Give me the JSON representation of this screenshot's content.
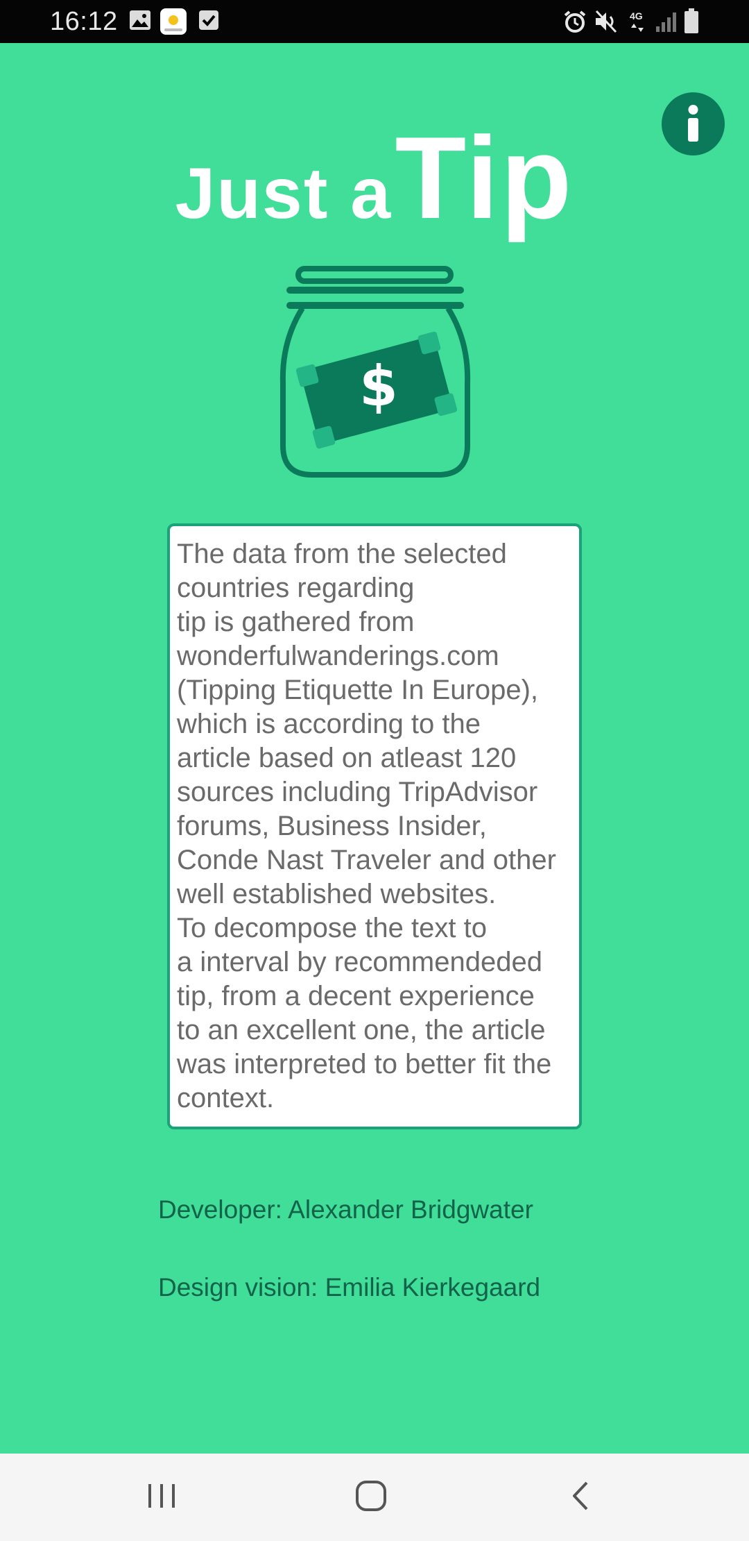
{
  "status_bar": {
    "time": "16:12",
    "left_icons": [
      "image-icon",
      "weather-app-icon",
      "checkbox-icon"
    ],
    "right_icons": [
      "alarm-icon",
      "mute-icon",
      "4g-icon",
      "signal-icon",
      "battery-icon"
    ]
  },
  "header": {
    "title_small": "Just a",
    "title_big": "Tip",
    "info_button_icon": "info-icon"
  },
  "logo": {
    "icon": "tip-jar-icon",
    "symbol": "$"
  },
  "about": {
    "text": "The data from the selected\ncountries regarding\ntip is gathered from\nwonderfulwanderings.com\n(Tipping Etiquette In Europe),\nwhich is according to the\narticle based on atleast 120\nsources including TripAdvisor\nforums, Business Insider,\nConde Nast Traveler and other\nwell established websites.\n        To decompose the text to\na interval by recommendeded\ntip, from a decent experience\nto an excellent one, the article\nwas interpreted to better fit the\ncontext."
  },
  "credits": {
    "developer": "Developer: Alexander Bridgwater",
    "design": "Design vision: Emilia Kierkegaard"
  },
  "nav_bar": {
    "recent_icon": "recent-apps-icon",
    "home_icon": "home-icon",
    "back_icon": "back-icon"
  },
  "colors": {
    "background": "#40de98",
    "accent_dark": "#0b7a5a",
    "card_border": "#1aa37a",
    "credit_text": "#12634a"
  }
}
